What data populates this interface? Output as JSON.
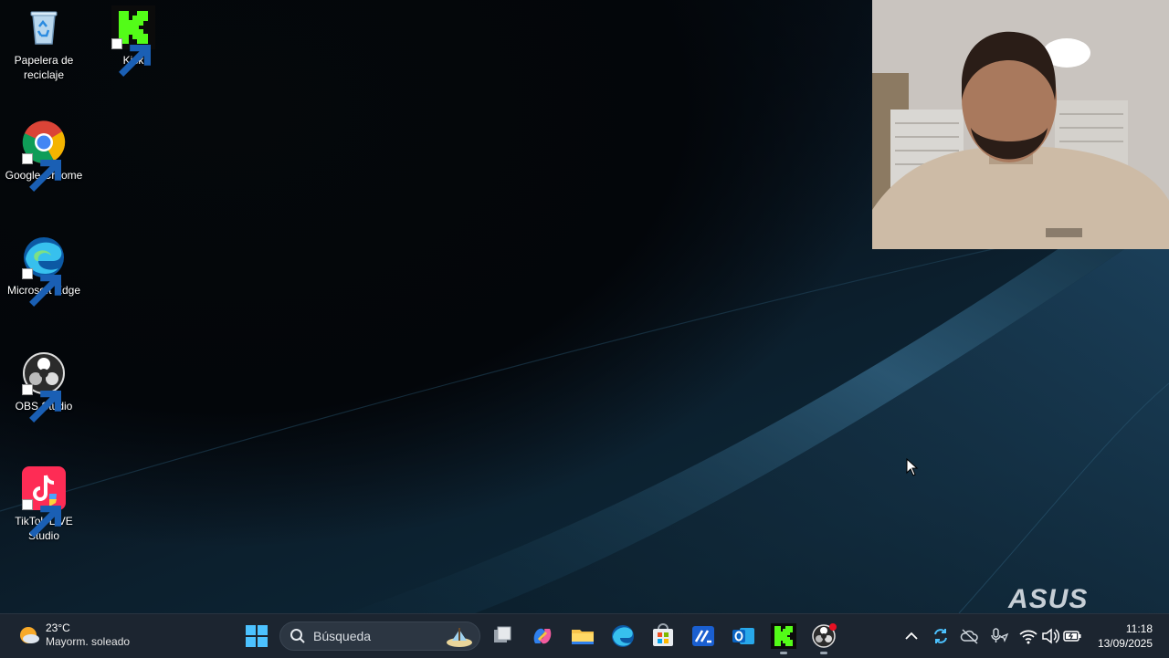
{
  "desktop": {
    "icons": [
      {
        "label": "Papelera de reciclaje",
        "icon": "recycle-bin-icon"
      },
      {
        "label": "Kick",
        "icon": "kick-icon"
      },
      {
        "label": "Google Chrome",
        "icon": "chrome-icon"
      },
      {
        "label": "Microsoft Edge",
        "icon": "edge-icon"
      },
      {
        "label": "OBS Studio",
        "icon": "obs-icon"
      },
      {
        "label": "TikTok LIVE Studio",
        "icon": "tiktok-live-icon"
      }
    ],
    "brand": "ASUS"
  },
  "taskbar": {
    "weather": {
      "temp": "23°C",
      "desc": "Mayorm. soleado"
    },
    "search": {
      "placeholder": "Búsqueda"
    },
    "apps": [
      "task-view-icon",
      "copilot-icon",
      "file-explorer-icon",
      "edge-icon",
      "store-icon",
      "myasus-icon",
      "outlook-icon",
      "kick-icon",
      "obs-icon"
    ],
    "clock": {
      "time": "11:18",
      "date": "13/09/2025"
    }
  },
  "colors": {
    "kick_green": "#53fc18",
    "taskbar_bg": "#1c2530",
    "accent": "#0078d4"
  }
}
